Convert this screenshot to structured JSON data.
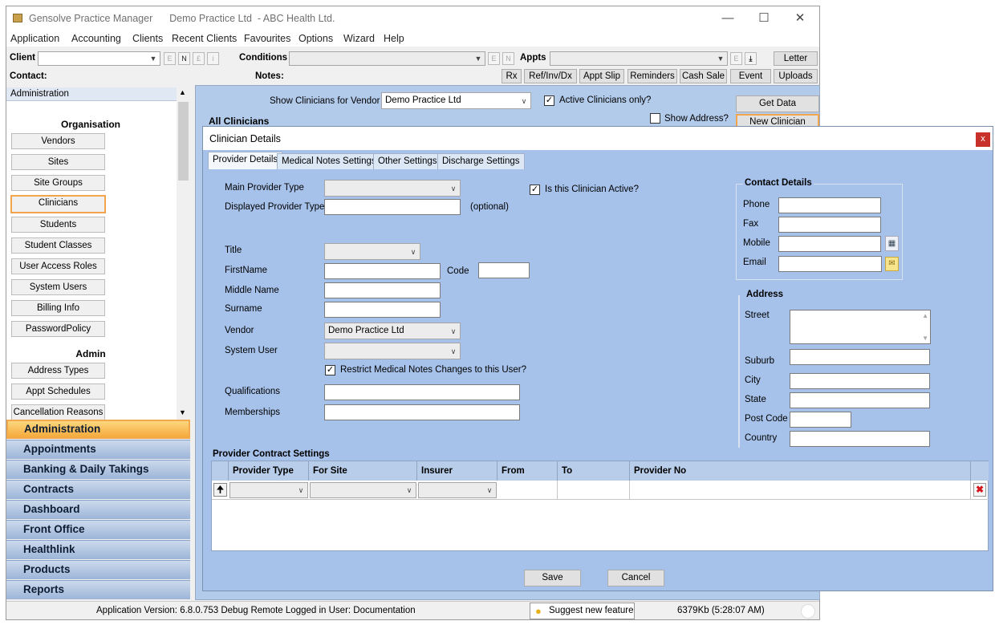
{
  "window": {
    "app_name": "Gensolve Practice Manager",
    "subtitle": "Demo Practice Ltd  - ABC Health Ltd."
  },
  "menu": [
    "Application",
    "Accounting",
    "Clients",
    "Recent Clients",
    "Favourites",
    "Options",
    "Wizard",
    "Help"
  ],
  "toolbar": {
    "client_label": "Client",
    "contact_label": "Contact:",
    "conditions_label": "Conditions",
    "notes_label": "Notes:",
    "appts_label": "Appts",
    "mini_e": "E",
    "mini_n": "N",
    "mini_pound": "£",
    "mini_i": "i",
    "letter": "Letter",
    "actions": [
      "Rx",
      "Ref/Inv/Dx",
      "Appt Slip",
      "Reminders",
      "Cash Sale",
      "Event",
      "Uploads"
    ]
  },
  "sidebar": {
    "header": "Administration",
    "organisation_title": "Organisation",
    "organisation_items": [
      "Vendors",
      "Sites",
      "Site Groups",
      "Clinicians",
      "Students",
      "Student Classes",
      "User Access Roles",
      "System Users",
      "Billing Info",
      "PasswordPolicy"
    ],
    "admin_title": "Admin",
    "admin_items": [
      "Address Types",
      "Appt Schedules",
      "Cancellation Reasons"
    ],
    "selected": "Clinicians"
  },
  "nav": [
    "Administration",
    "Appointments",
    "Banking & Daily Takings",
    "Contracts",
    "Dashboard",
    "Front Office",
    "Healthlink",
    "Products",
    "Reports"
  ],
  "clinicians_panel": {
    "vendor_label": "Show Clinicians for Vendor",
    "vendor_value": "Demo Practice Ltd",
    "active_only_label": "Active Clinicians only?",
    "active_only_checked": true,
    "show_address_label": "Show Address?",
    "show_address_checked": false,
    "get_data": "Get Data",
    "new_clinician": "New Clinician",
    "list_title": "All Clinicians"
  },
  "dialog": {
    "title": "Clinician Details",
    "close": "x",
    "tabs": [
      "Provider Details",
      "Medical Notes Settings",
      "Other Settings",
      "Discharge Settings"
    ],
    "active_tab": "Provider Details",
    "main_provider_type_label": "Main Provider Type",
    "displayed_provider_type_label": "Displayed Provider Type",
    "optional_hint": "(optional)",
    "is_active_label": "Is this Clinician Active?",
    "is_active_checked": true,
    "title_label": "Title",
    "firstname_label": "FirstName",
    "code_label": "Code",
    "middle_name_label": "Middle Name",
    "surname_label": "Surname",
    "vendor_label": "Vendor",
    "vendor_value": "Demo Practice Ltd",
    "system_user_label": "System User",
    "restrict_label": "Restrict Medical Notes Changes to this User?",
    "restrict_checked": true,
    "qualifications_label": "Qualifications",
    "memberships_label": "Memberships",
    "contact": {
      "title": "Contact Details",
      "phone": "Phone",
      "fax": "Fax",
      "mobile": "Mobile",
      "email": "Email"
    },
    "address": {
      "title": "Address",
      "street": "Street",
      "suburb": "Suburb",
      "city": "City",
      "state": "State",
      "post_code": "Post Code",
      "country": "Country"
    },
    "contract": {
      "title": "Provider Contract Settings",
      "columns": [
        "Provider Type",
        "For Site",
        "Insurer",
        "From",
        "To",
        "Provider No"
      ]
    },
    "save": "Save",
    "cancel": "Cancel"
  },
  "status": {
    "version": "Application Version: 6.8.0.753 Debug Remote  Logged in User: Documentation",
    "suggest": "Suggest new feature",
    "memory": "6379Kb  (5:28:07 AM)"
  },
  "colors": {
    "nav_active": "#f5a93b",
    "highlight_border": "#f3a54d",
    "dialog_bg": "#a6c2ea",
    "close_red": "#c8312a"
  }
}
